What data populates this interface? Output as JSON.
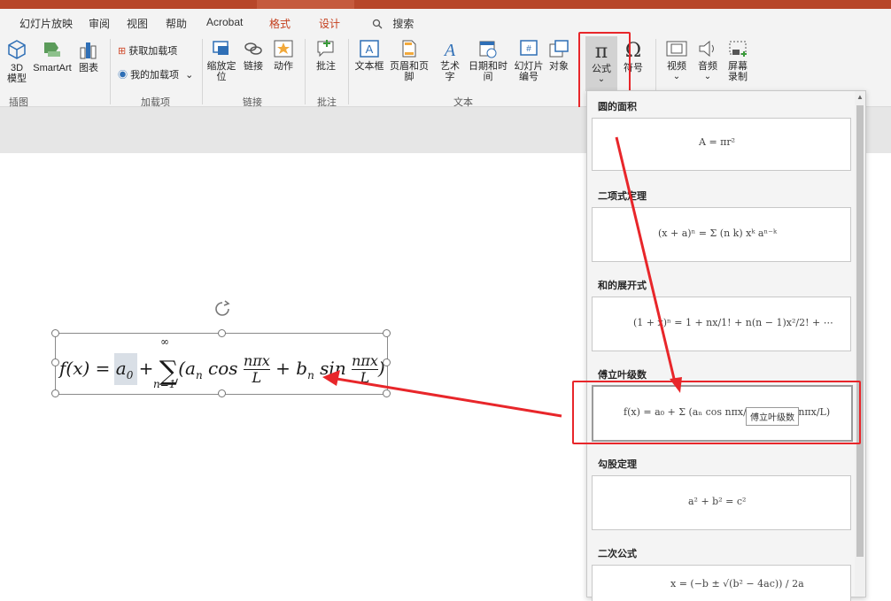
{
  "tabs": [
    "幻灯片放映",
    "审阅",
    "视图",
    "帮助",
    "Acrobat",
    "格式",
    "设计"
  ],
  "search_label": "搜索",
  "ribbon": {
    "groups": {
      "illustrations": "插图",
      "addins": "加载项",
      "links": "链接",
      "comments": "批注",
      "text": "文本"
    },
    "buttons": {
      "model3d": "3D\n模型",
      "smartart": "SmartArt",
      "chart": "图表",
      "get_addins": "获取加载项",
      "my_addins": "我的加载项",
      "zoom": "缩放定\n位",
      "link": "链接",
      "action": "动作",
      "comment": "批注",
      "textbox": "文本框",
      "header_footer": "页眉和页脚",
      "wordart": "艺术字",
      "datetime": "日期和时间",
      "slide_number": "幻灯片\n编号",
      "object": "对象",
      "equation": "公式",
      "symbol": "符号",
      "video": "视频",
      "audio": "音频",
      "screen_record": "屏幕\n录制"
    }
  },
  "panel": {
    "sections": [
      {
        "title": "圆的面积",
        "formula": "A = πr²"
      },
      {
        "title": "二项式定理",
        "formula": "(x + a)ⁿ = Σ (n k) xᵏ aⁿ⁻ᵏ"
      },
      {
        "title": "和的展开式",
        "formula": "(1 + x)ⁿ = 1 + nx/1! + n(n − 1)x²/2! + ⋯"
      },
      {
        "title": "傅立叶级数",
        "formula": "f(x) = a₀ + Σ (aₙ cos nπx/L + bₙ sin nπx/L)"
      },
      {
        "title": "勾股定理",
        "formula": "a² + b² = c²"
      },
      {
        "title": "二次公式",
        "formula": "x = (−b ± √(b² − 4ac)) / 2a"
      }
    ],
    "tooltip": "傅立叶级数"
  },
  "slide_equation": "f(x) = a₀ + Σ (aₙ cos nπx/L + bₙ sin nπx/L)",
  "colors": {
    "accent": "#b7472a",
    "highlight": "#e8262a"
  }
}
